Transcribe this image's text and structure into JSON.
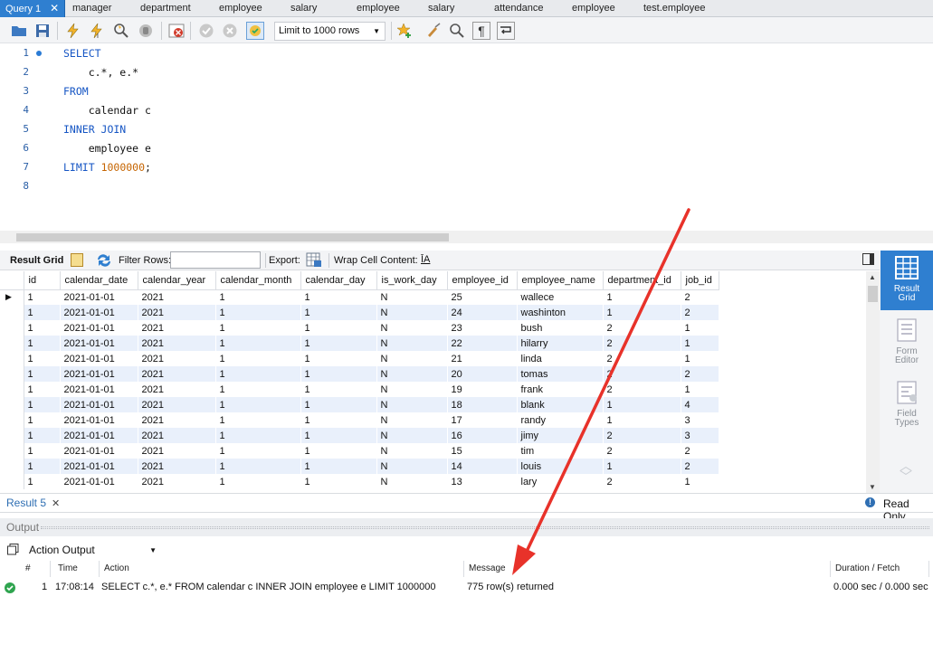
{
  "tabs": [
    "Query 1",
    "manager",
    "department",
    "employee",
    "salary",
    "employee",
    "salary",
    "attendance",
    "employee",
    "test.employee"
  ],
  "toolbar": {
    "limit_label": "Limit to 1000 rows"
  },
  "editor": {
    "lines": [
      {
        "n": "1",
        "text": "SELECT"
      },
      {
        "n": "2",
        "text": "    c.*, e.*"
      },
      {
        "n": "3",
        "text": "FROM"
      },
      {
        "n": "4",
        "text": "    calendar c"
      },
      {
        "n": "5",
        "text": "INNER JOIN"
      },
      {
        "n": "6",
        "text": "    employee e"
      },
      {
        "n": "7",
        "text": "LIMIT 1000000;"
      },
      {
        "n": "8",
        "text": ""
      }
    ]
  },
  "result_toolbar": {
    "result_grid": "Result Grid",
    "filter_rows": "Filter Rows:",
    "export": "Export:",
    "wrap": "Wrap Cell Content:"
  },
  "grid": {
    "columns": [
      "id",
      "calendar_date",
      "calendar_year",
      "calendar_month",
      "calendar_day",
      "is_work_day",
      "employee_id",
      "employee_name",
      "department_id",
      "job_id"
    ],
    "rows": [
      [
        "1",
        "2021-01-01",
        "2021",
        "1",
        "1",
        "N",
        "25",
        "wallece",
        "1",
        "2"
      ],
      [
        "1",
        "2021-01-01",
        "2021",
        "1",
        "1",
        "N",
        "24",
        "washinton",
        "1",
        "2"
      ],
      [
        "1",
        "2021-01-01",
        "2021",
        "1",
        "1",
        "N",
        "23",
        "bush",
        "2",
        "1"
      ],
      [
        "1",
        "2021-01-01",
        "2021",
        "1",
        "1",
        "N",
        "22",
        "hilarry",
        "2",
        "1"
      ],
      [
        "1",
        "2021-01-01",
        "2021",
        "1",
        "1",
        "N",
        "21",
        "linda",
        "2",
        "1"
      ],
      [
        "1",
        "2021-01-01",
        "2021",
        "1",
        "1",
        "N",
        "20",
        "tomas",
        "2",
        "2"
      ],
      [
        "1",
        "2021-01-01",
        "2021",
        "1",
        "1",
        "N",
        "19",
        "frank",
        "2",
        "1"
      ],
      [
        "1",
        "2021-01-01",
        "2021",
        "1",
        "1",
        "N",
        "18",
        "blank",
        "1",
        "4"
      ],
      [
        "1",
        "2021-01-01",
        "2021",
        "1",
        "1",
        "N",
        "17",
        "randy",
        "1",
        "3"
      ],
      [
        "1",
        "2021-01-01",
        "2021",
        "1",
        "1",
        "N",
        "16",
        "jimy",
        "2",
        "3"
      ],
      [
        "1",
        "2021-01-01",
        "2021",
        "1",
        "1",
        "N",
        "15",
        "tim",
        "2",
        "2"
      ],
      [
        "1",
        "2021-01-01",
        "2021",
        "1",
        "1",
        "N",
        "14",
        "louis",
        "1",
        "2"
      ],
      [
        "1",
        "2021-01-01",
        "2021",
        "1",
        "1",
        "N",
        "13",
        "lary",
        "2",
        "1"
      ]
    ]
  },
  "side_panel": {
    "result_grid": [
      "Result",
      "Grid"
    ],
    "form_editor": [
      "Form",
      "Editor"
    ],
    "field_types": [
      "Field",
      "Types"
    ]
  },
  "result_tab": {
    "label": "Result 5",
    "read_only": "Read Only"
  },
  "output": {
    "title": "Output",
    "selector": "Action Output",
    "headers": {
      "num": "#",
      "time": "Time",
      "action": "Action",
      "message": "Message",
      "duration": "Duration / Fetch"
    },
    "row": {
      "num": "1",
      "time": "17:08:14",
      "action": "SELECT  c.*, e.* FROM calendar c INNER JOIN employee e LIMIT 1000000",
      "message": "775 row(s) returned",
      "duration": "0.000 sec / 0.000 sec"
    }
  },
  "colors": {
    "accent": "#2f7fd0",
    "keyword": "#1656c4",
    "number": "#c56400",
    "annotation_arrow": "#e8322a",
    "success": "#2fa44f"
  }
}
